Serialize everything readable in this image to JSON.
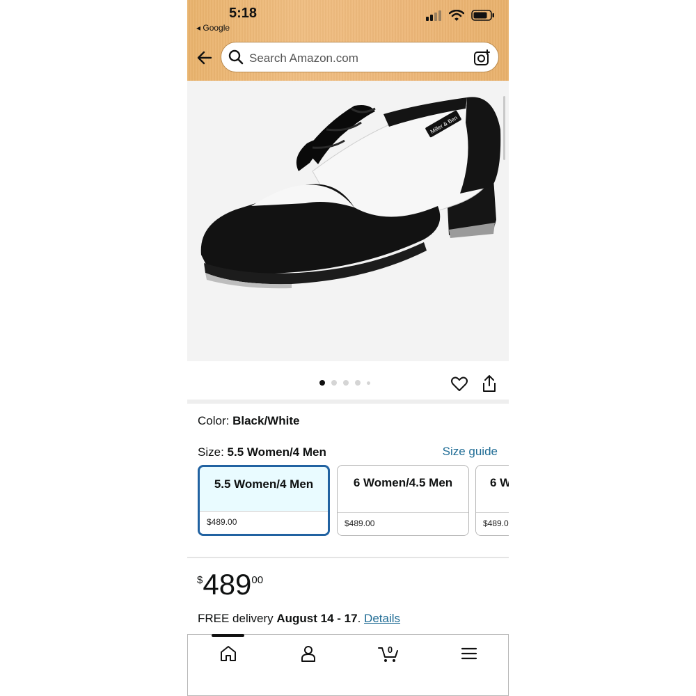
{
  "status_bar": {
    "time": "5:18",
    "back_app": "◂ Google"
  },
  "search": {
    "placeholder": "Search Amazon.com"
  },
  "product_image": {
    "brand_tag": "Miller & Ben",
    "carousel_dots": 5,
    "active_dot": 0
  },
  "color": {
    "label": "Color:",
    "value": "Black/White"
  },
  "size": {
    "label": "Size:",
    "value": "5.5 Women/4 Men",
    "guide_link": "Size guide",
    "options": [
      {
        "name": "5.5 Women/4 Men",
        "price": "$489.00",
        "selected": true
      },
      {
        "name": "6 Women/4.5 Men",
        "price": "$489.00",
        "selected": false
      },
      {
        "name": "6 W",
        "price": "$489.0",
        "selected": false
      }
    ]
  },
  "price": {
    "symbol": "$",
    "whole": "489",
    "fraction": "00"
  },
  "delivery": {
    "prefix": "FREE delivery",
    "dates": "August 14 - 17",
    "separator": ".",
    "details_link": "Details"
  },
  "bottom_nav": {
    "cart_count": "0",
    "items": [
      "home-icon",
      "account-icon",
      "cart-icon",
      "menu-icon"
    ]
  },
  "colors": {
    "header": "#ebb573",
    "link": "#1f6c95",
    "selected_border": "#2162a1",
    "selected_bg": "#e9fbff"
  }
}
